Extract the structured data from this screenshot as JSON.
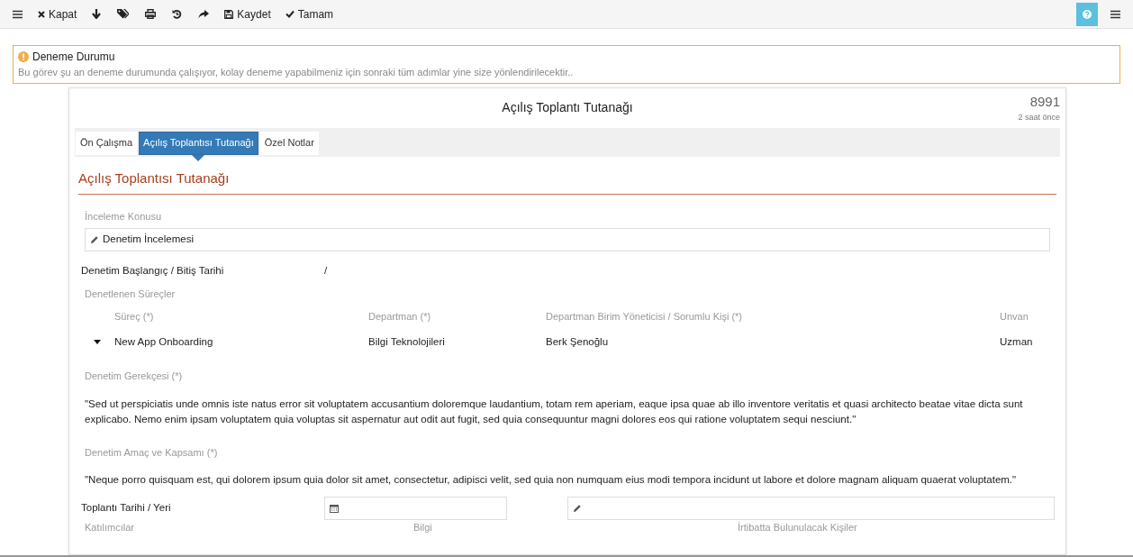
{
  "toolbar": {
    "items": [
      {
        "kind": "menu"
      },
      {
        "kind": "close",
        "label": "Kapat"
      },
      {
        "kind": "down"
      },
      {
        "kind": "tags"
      },
      {
        "kind": "print"
      },
      {
        "kind": "undo"
      },
      {
        "kind": "share"
      },
      {
        "kind": "save",
        "label": "Kaydet"
      },
      {
        "kind": "check",
        "label": "Tamam"
      }
    ],
    "right": [
      {
        "kind": "help"
      },
      {
        "kind": "menu"
      }
    ]
  },
  "notice": {
    "title": "Deneme Durumu",
    "text": "Bu görev şu an deneme durumunda çalışıyor, kolay deneme yapabilmeniz için sonraki tüm adımlar yine size yönlendirilecektir.."
  },
  "document": {
    "title": "Açılış Toplantı Tutanağı",
    "number": "8991",
    "time": "2 saat önce"
  },
  "tabs": [
    {
      "label": "Ön Çalışma",
      "selected": false
    },
    {
      "label": "Açılış Toplantısı Tutanağı",
      "selected": true
    },
    {
      "label": "Özel Notlar",
      "selected": false
    }
  ],
  "section_title": "Açılış Toplantısı Tutanağı",
  "subject": {
    "label": "İnceleme Konusu",
    "value": "Denetim İncelemesi"
  },
  "dates": {
    "label": "Denetim Başlangıç / Bitiş Tarihi",
    "value": "/"
  },
  "processes": {
    "label": "Denetlenen Süreçler",
    "columns": [
      "Süreç (*)",
      "Departman (*)",
      "Departman Birim Yöneticisi / Sorumlu Kişi (*)",
      "Unvan"
    ],
    "rows": [
      {
        "expanded": false,
        "cells": [
          "New App Onboarding",
          "Bilgi Teknolojileri",
          "Berk Şenoğlu",
          "Uzman"
        ]
      }
    ]
  },
  "reason": {
    "label": "Denetim Gerekçesi (*)",
    "text": "\"Sed ut perspiciatis unde omnis iste natus error sit voluptatem accusantium doloremque laudantium, totam rem aperiam, eaque ipsa quae ab illo inventore veritatis et quasi architecto beatae vitae dicta sunt explicabo. Nemo enim ipsam voluptatem quia voluptas sit aspernatur aut odit aut fugit, sed quia consequuntur magni dolores eos qui ratione voluptatem sequi nesciunt.\""
  },
  "scope": {
    "label": "Denetim Amaç ve Kapsamı (*)",
    "text": "\"Neque porro quisquam est, qui dolorem ipsum quia dolor sit amet, consectetur, adipisci velit, sed quia non numquam eius modi tempora incidunt ut labore et dolore magnam aliquam quaerat voluptatem.\""
  },
  "meeting": {
    "label": "Toplantı Tarihi / Yeri"
  },
  "participants_columns": [
    "Katılımcılar",
    "Bilgi",
    "İrtibatta Bulunulacak Kişiler"
  ]
}
